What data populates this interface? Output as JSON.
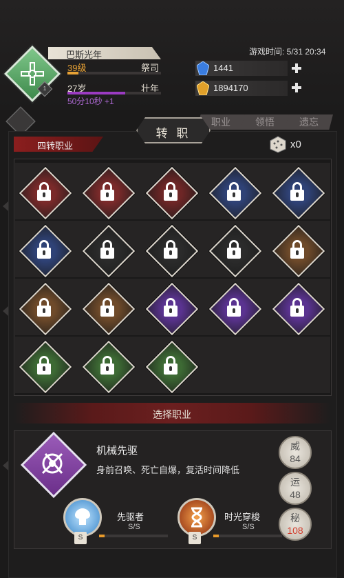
{
  "header": {
    "player_name": "巴斯光年",
    "level_label": "39级",
    "class_label": "祭司",
    "level_progress": 0.12,
    "age_label": "27岁",
    "stage_label": "壮年",
    "age_progress": 0.62,
    "timer_text": "50分10秒 +1",
    "rank_badge": "1",
    "game_time": "游戏时间: 5/31 20:34",
    "gems": "1441",
    "gold": "1894170"
  },
  "tabs": [
    "职业",
    "领悟",
    "遗忘"
  ],
  "title": "转 职",
  "ribbon_label": "四转职业",
  "dice_count": "x0",
  "job_tiles": [
    {
      "color": "#7a2a2a"
    },
    {
      "color": "#7a2a2a"
    },
    {
      "color": "#6e2626"
    },
    {
      "color": "#2f4276"
    },
    {
      "color": "#2f4276"
    },
    {
      "color": "#2f4276"
    },
    {
      "color": "#2b2b2b"
    },
    {
      "color": "#2b2b2b"
    },
    {
      "color": "#2b2b2b"
    },
    {
      "color": "#6e4a2a"
    },
    {
      "color": "#6e4a2a"
    },
    {
      "color": "#6e4a2a"
    },
    {
      "color": "#5a3390"
    },
    {
      "color": "#5a3390"
    },
    {
      "color": "#5a3390"
    },
    {
      "color": "#3d6a34"
    },
    {
      "color": "#3d6a34"
    },
    {
      "color": "#3d6a34"
    }
  ],
  "section_title": "选择职业",
  "selected": {
    "name": "机械先驱",
    "desc": "身前召唤、死亡自爆，复活时间降低"
  },
  "stats": [
    {
      "key": "威",
      "value": "84",
      "color": "#555555"
    },
    {
      "key": "运",
      "value": "48",
      "color": "#555555"
    },
    {
      "key": "秘",
      "value": "108",
      "color": "#d23b2b"
    }
  ],
  "skills": [
    {
      "name": "先驱者",
      "grade": "S/S",
      "tag": "S",
      "color": "#6fb6e8"
    },
    {
      "name": "时光穿梭",
      "grade": "S/S",
      "tag": "S",
      "color": "#d86a28"
    }
  ]
}
